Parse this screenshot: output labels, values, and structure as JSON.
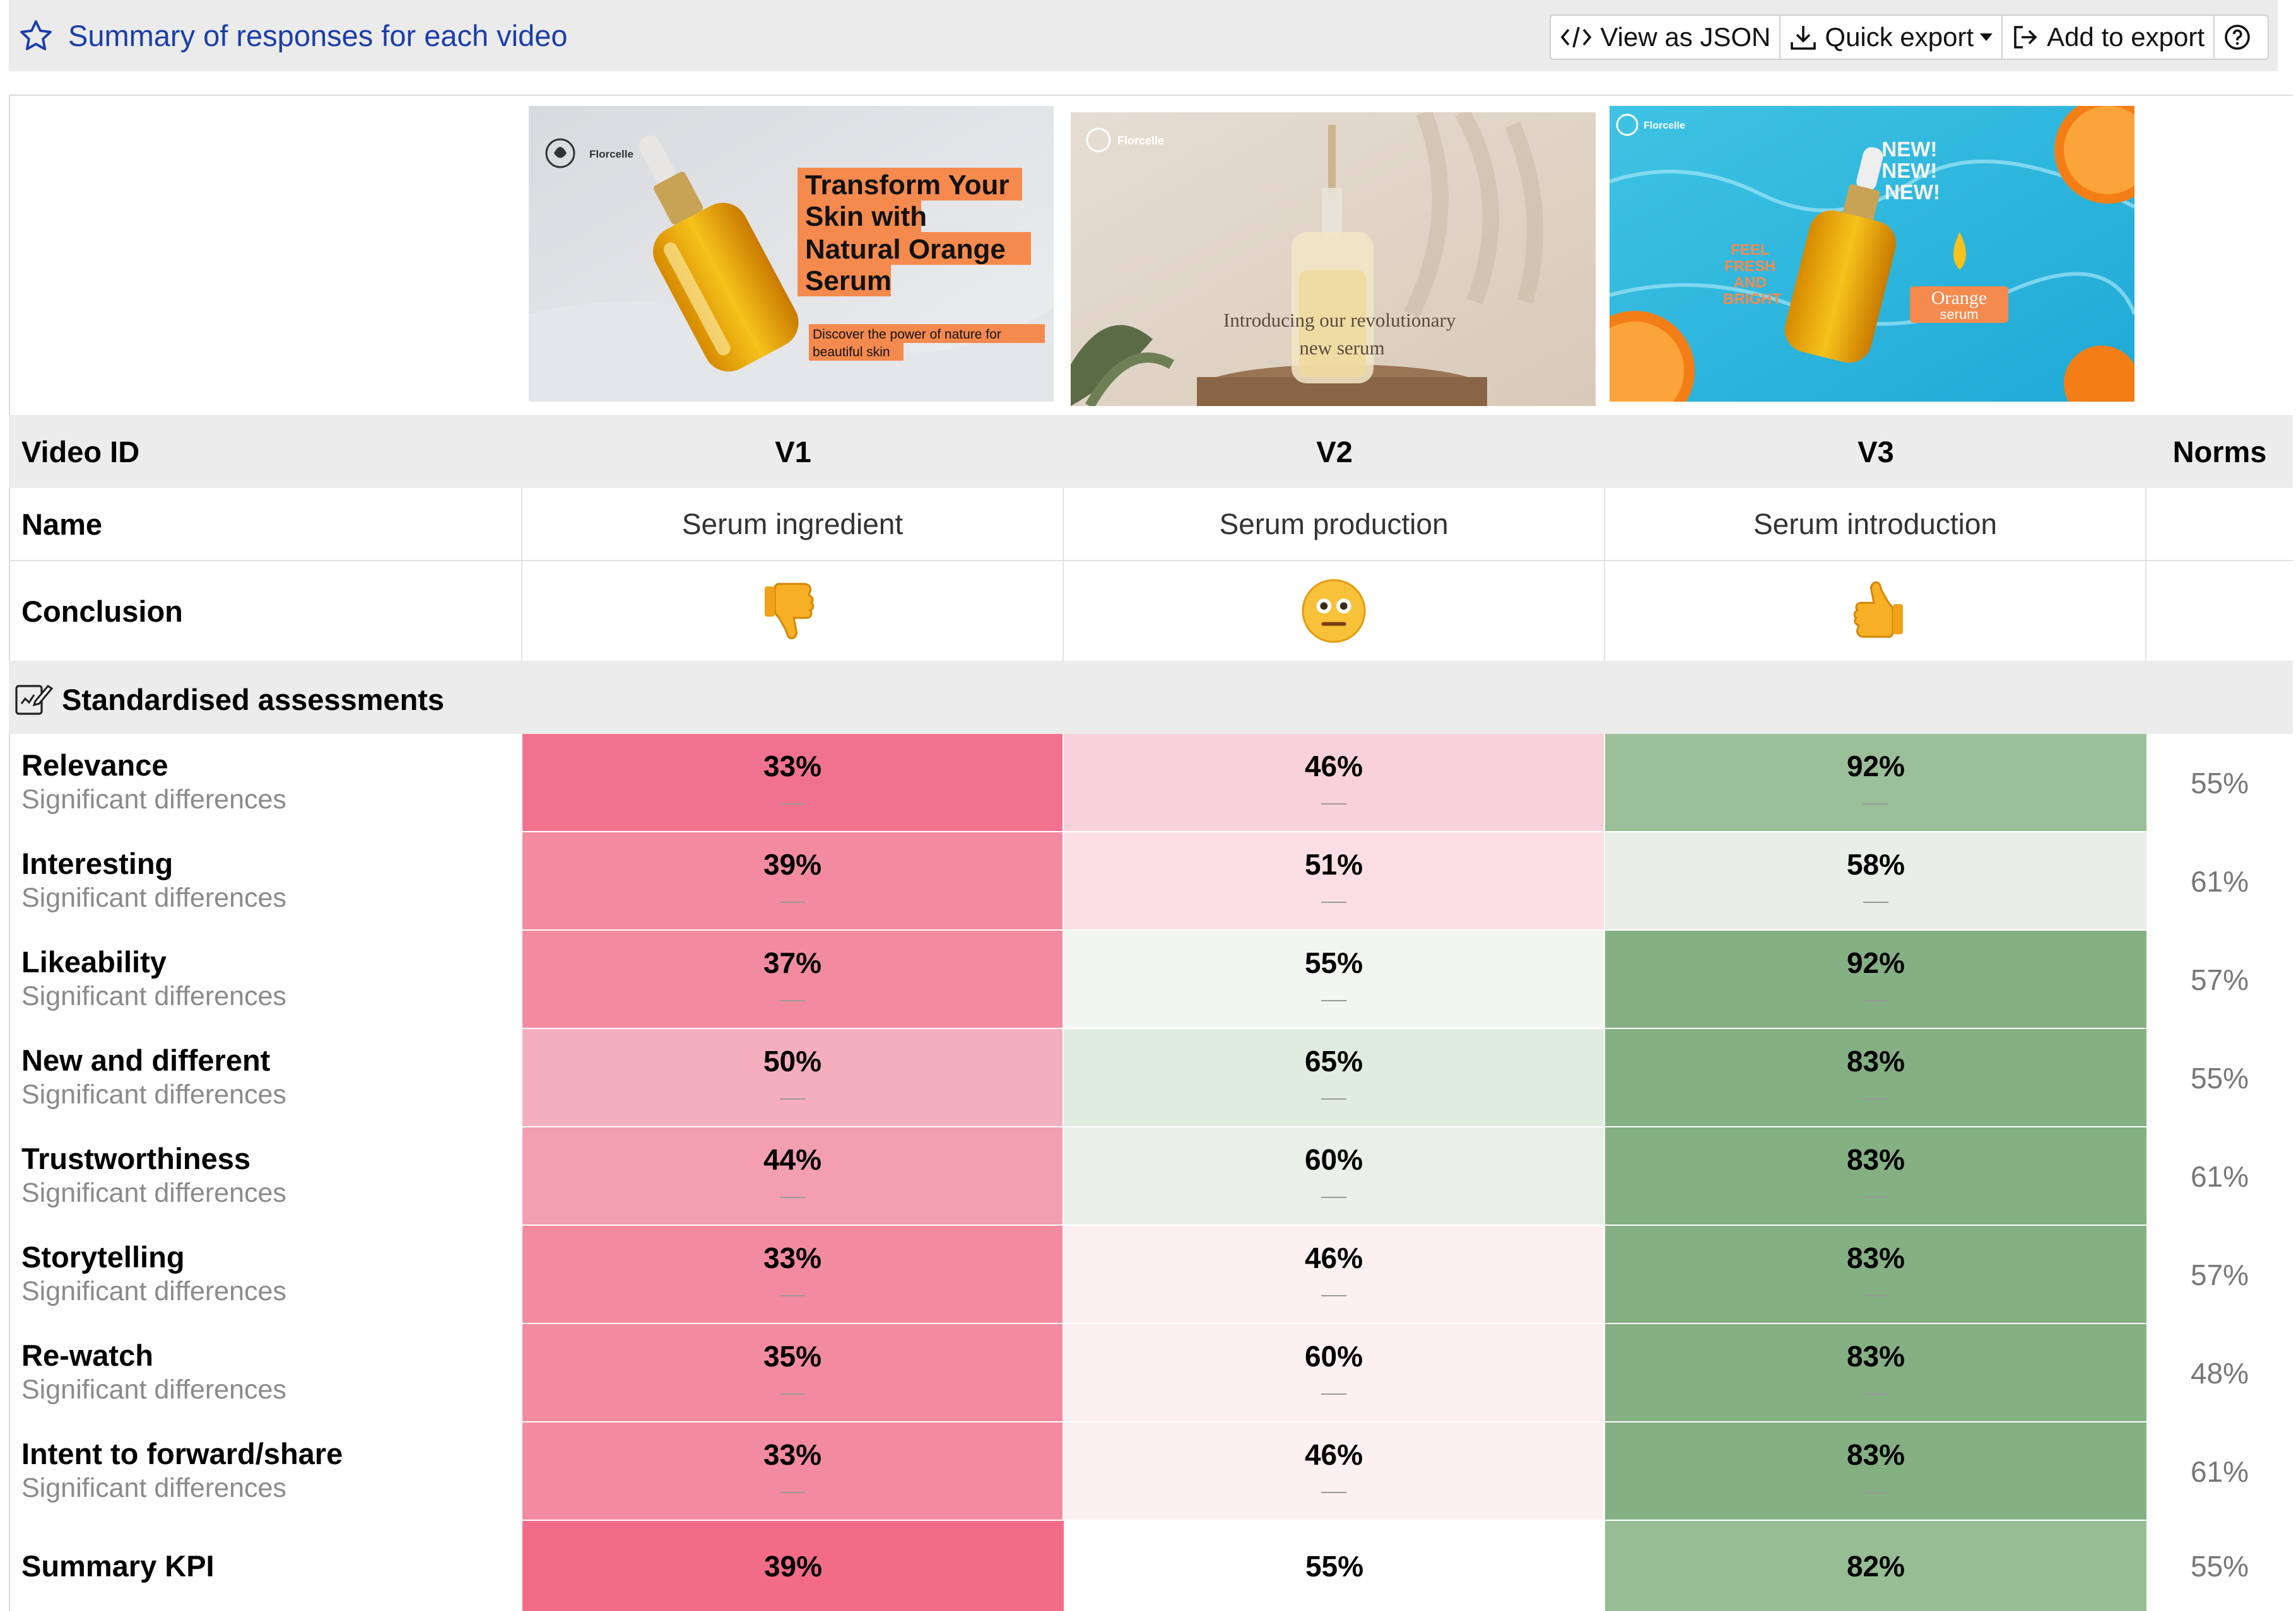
{
  "header": {
    "title": "Summary of responses for each video",
    "buttons": {
      "view_json": "View as JSON",
      "quick_export": "Quick export",
      "add_to_export": "Add to export"
    }
  },
  "thumbnails": [
    {
      "brand": "Florcelle",
      "headline": [
        "Transform Your",
        "Skin with",
        "Natural Orange",
        "Serum"
      ],
      "tagline": [
        "Discover the power of nature for",
        "beautiful skin"
      ]
    },
    {
      "brand": "Florcelle",
      "text": [
        "Introducing our revolutionary",
        "new serum"
      ]
    },
    {
      "brand": "Florcelle",
      "badge": [
        "NEW!",
        "NEW!",
        "NEW!"
      ],
      "side": [
        "FEEL",
        "FRESH",
        "AND",
        "BRIGHT"
      ],
      "product": [
        "Orange",
        "serum"
      ]
    }
  ],
  "table": {
    "col_headers": {
      "video_id": "Video ID",
      "v1": "V1",
      "v2": "V2",
      "v3": "V3",
      "norms": "Norms"
    },
    "name_row": {
      "label": "Name",
      "v1": "Serum ingredient",
      "v2": "Serum production",
      "v3": "Serum introduction"
    },
    "conclusion_row": {
      "label": "Conclusion",
      "v1": "👎",
      "v2": "😐",
      "v3": "👍"
    },
    "section_title": "Standardised assessments",
    "sub_label": "Significant differences",
    "rows": [
      {
        "label": "Relevance",
        "v1": "33%",
        "v2": "46%",
        "v3": "92%",
        "norm": "55%",
        "c1": "#f1728f",
        "c2": "#f9d1da",
        "c3": "#9bbf98"
      },
      {
        "label": "Interesting",
        "v1": "39%",
        "v2": "51%",
        "v3": "58%",
        "norm": "61%",
        "c1": "#f38ba0",
        "c2": "#fbdfe4",
        "c3": "#e7efe6"
      },
      {
        "label": "Likeability",
        "v1": "37%",
        "v2": "55%",
        "v3": "92%",
        "norm": "57%",
        "c1": "#f38ba0",
        "c2": "#f1f6f0",
        "c3": "#84b084"
      },
      {
        "label": "New and different",
        "v1": "50%",
        "v2": "65%",
        "v3": "83%",
        "norm": "55%",
        "c1": "#f5aebe",
        "c2": "#e1ece0",
        "c3": "#84b084"
      },
      {
        "label": "Trustworthiness",
        "v1": "44%",
        "v2": "60%",
        "v3": "83%",
        "norm": "61%",
        "c1": "#f39fb1",
        "c2": "#e8f0e7",
        "c3": "#84b084"
      },
      {
        "label": "Storytelling",
        "v1": "33%",
        "v2": "46%",
        "v3": "83%",
        "norm": "57%",
        "c1": "#f38ba0",
        "c2": "#fcf0f2",
        "c3": "#84b084"
      },
      {
        "label": "Re-watch",
        "v1": "35%",
        "v2": "60%",
        "v3": "83%",
        "norm": "48%",
        "c1": "#f38ba0",
        "c2": "#fcf0f2",
        "c3": "#84b084"
      },
      {
        "label": "Intent to forward/share",
        "v1": "33%",
        "v2": "46%",
        "v3": "83%",
        "norm": "61%",
        "c1": "#f38ba0",
        "c2": "#fcf0f2",
        "c3": "#84b084"
      }
    ],
    "summary": {
      "label": "Summary KPI",
      "v1": "39%",
      "v2": "55%",
      "v3": "82%",
      "norm": "55%",
      "c1": "#f26c88",
      "c2": "#ffffff",
      "c3": "#96bd94"
    }
  },
  "colors": {
    "title": "#1c3ea8",
    "header_bg": "#ebebeb",
    "sub_text": "#8a8a8a"
  }
}
